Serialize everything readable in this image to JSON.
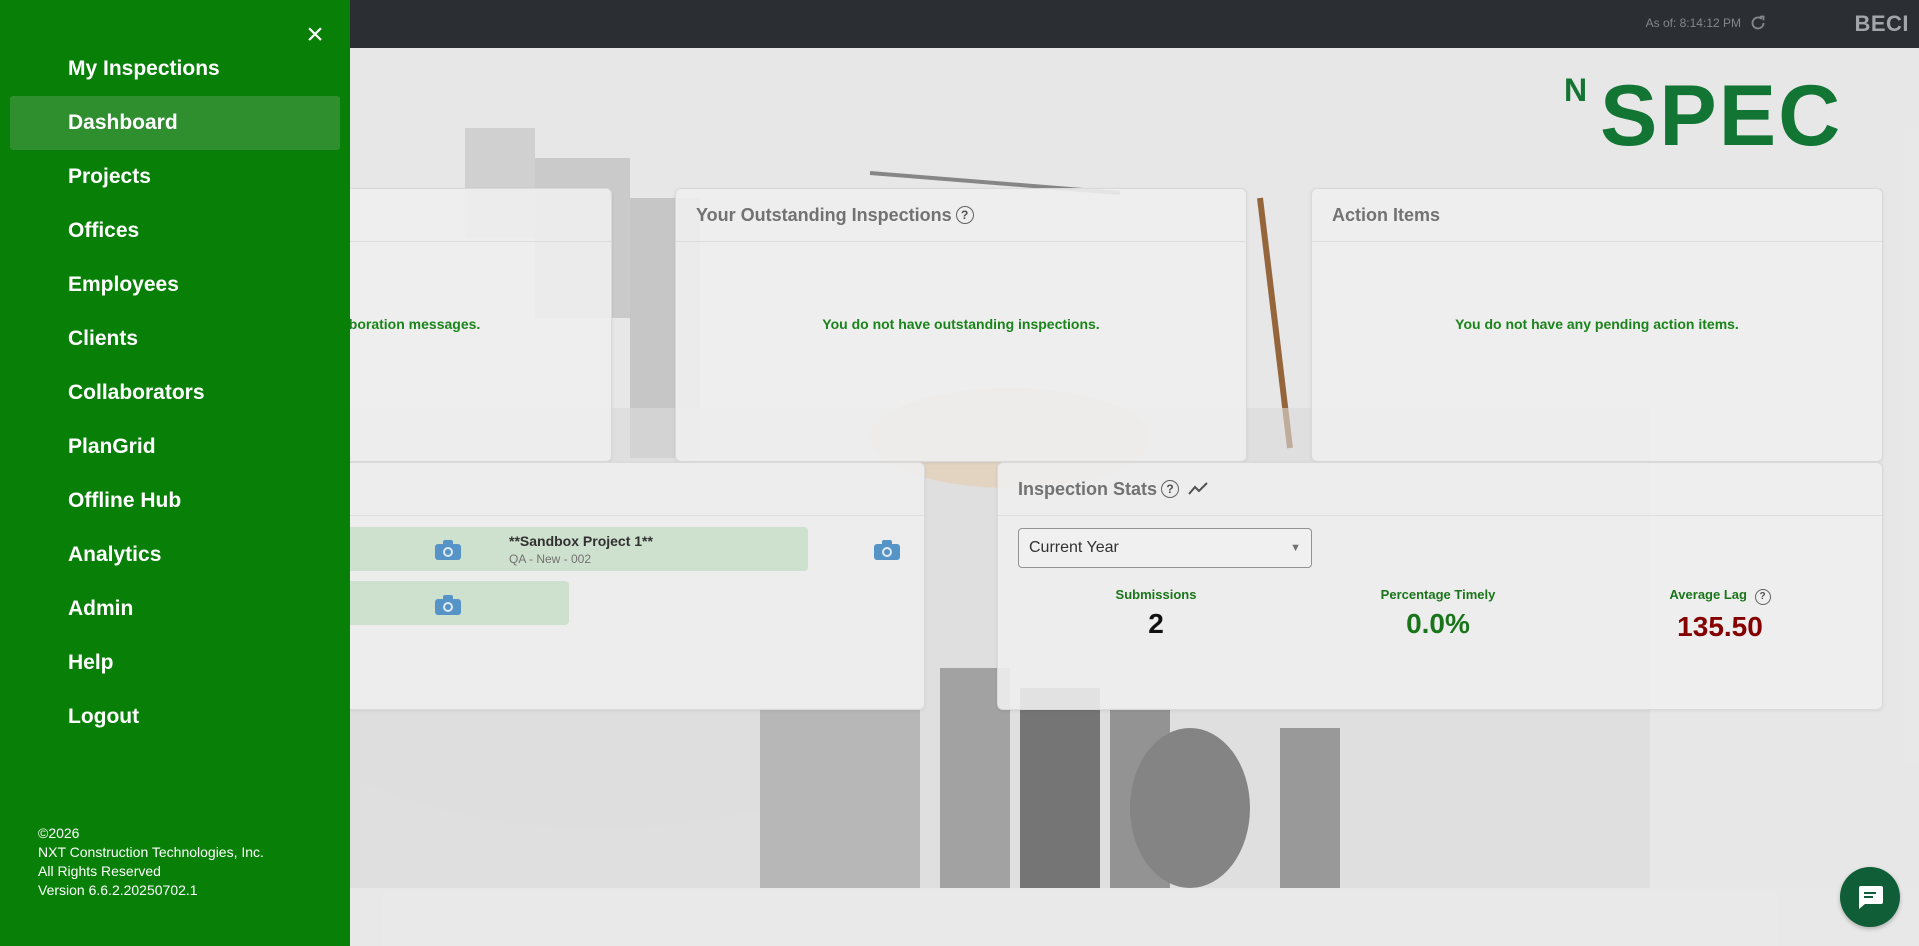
{
  "topbar": {
    "as_of": "As of: 8:14:12 PM",
    "org": "BECI",
    "refresh_icon": "refresh-icon"
  },
  "logo": {
    "n": "N",
    "spec": "SPEC"
  },
  "cards": {
    "collab_msg": "aboration messages.",
    "outstanding": {
      "title": "Your Outstanding Inspections",
      "help": "?",
      "msg": "You do not have outstanding inspections."
    },
    "actions": {
      "title": "Action Items",
      "msg": "You do not have any pending action items."
    }
  },
  "projects": {
    "tile": {
      "title": "**Sandbox Project 1**",
      "sub": "QA - New - 002"
    }
  },
  "stats": {
    "title": "Inspection Stats",
    "help": "?",
    "period": "Current Year",
    "submissions": {
      "label": "Submissions",
      "value": "2",
      "color": "#111111"
    },
    "timely": {
      "label": "Percentage Timely",
      "value": "0.0%",
      "color": "#1c7a1c"
    },
    "lag": {
      "label": "Average Lag",
      "value": "135.50",
      "color": "#8b0000"
    }
  },
  "sidebar": {
    "close": "×",
    "items": [
      {
        "label": "My Inspections"
      },
      {
        "label": "Dashboard"
      },
      {
        "label": "Projects"
      },
      {
        "label": "Offices"
      },
      {
        "label": "Employees"
      },
      {
        "label": "Clients"
      },
      {
        "label": "Collaborators"
      },
      {
        "label": "PlanGrid"
      },
      {
        "label": "Offline Hub"
      },
      {
        "label": "Analytics"
      },
      {
        "label": "Admin"
      },
      {
        "label": "Help"
      },
      {
        "label": "Logout"
      }
    ],
    "active_index": 1,
    "footer": {
      "copyright": "©2026",
      "company": "NXT Construction Technologies, Inc.",
      "rights": "All Rights Reserved",
      "version": "Version 6.6.2.20250702.1"
    }
  },
  "colors": {
    "sidebar": "#088008",
    "accent_green": "#137a37",
    "topbar": "#2d3035"
  }
}
